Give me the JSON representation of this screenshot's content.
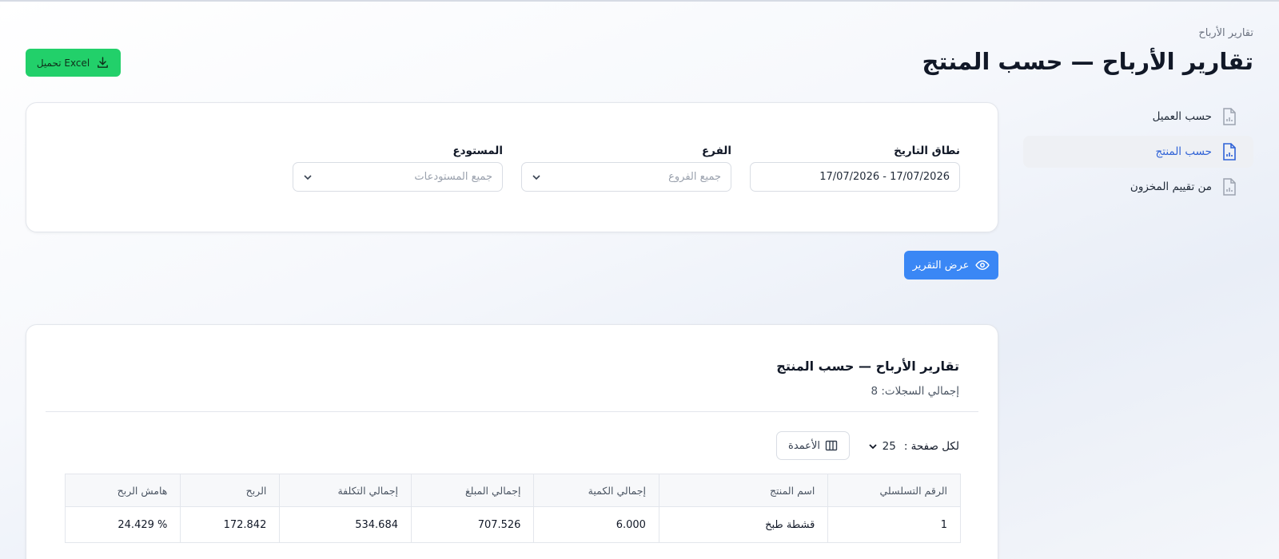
{
  "header": {
    "breadcrumb": "تقارير الأرباح",
    "title": "تقارير الأرباح — حسب المنتج",
    "excel_label": "تحميل Excel"
  },
  "sidebar": {
    "items": [
      {
        "label": "حسب العميل",
        "icon": "document-chart-icon",
        "active": false
      },
      {
        "label": "حسب المنتج",
        "icon": "document-chart-icon",
        "active": true
      },
      {
        "label": "من تقييم المخزون",
        "icon": "document-chart-icon",
        "active": false
      }
    ]
  },
  "filters": {
    "date_range": {
      "label": "نطاق التاريخ",
      "value": "17/07/2026 - 17/07/2026"
    },
    "branch": {
      "label": "الفرع",
      "placeholder": "جميع الفروع"
    },
    "warehouse": {
      "label": "المستودع",
      "placeholder": "جميع المستودعات"
    }
  },
  "show_report_label": "عرض التقرير",
  "report": {
    "title": "تقارير الأرباح — حسب المنتج",
    "total_records": "إجمالي السجلات: 8",
    "per_page_label": "لكل صفحة :",
    "per_page_value": "25",
    "columns_label": "الأعمدة",
    "table": {
      "headers": [
        "الرقم التسلسلي",
        "اسم المنتج",
        "إجمالي الكمية",
        "إجمالي المبلغ",
        "إجمالي التكلفة",
        "الربح",
        "هامش الربح"
      ],
      "rows": [
        [
          "1",
          "قشطة طبخ",
          "6.000",
          "707.526",
          "534.684",
          "172.842",
          "24.429 %"
        ]
      ]
    }
  },
  "colors": {
    "excel_button": "#22d06a",
    "primary_button": "#3a87f5",
    "active_nav_text": "#2f62d6"
  }
}
